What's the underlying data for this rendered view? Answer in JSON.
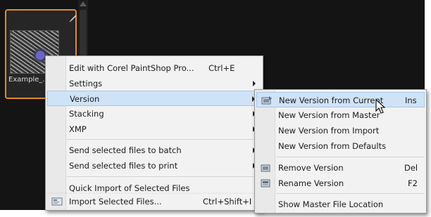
{
  "thumbnail": {
    "label": "Example_...S"
  },
  "main_menu": {
    "items": [
      {
        "label": "Edit with Corel PaintShop Pro...",
        "shortcut": "Ctrl+E"
      },
      {
        "label": "Settings"
      },
      {
        "label": "Version"
      },
      {
        "label": "Stacking"
      },
      {
        "label": "XMP"
      },
      {
        "label": "Send selected files to batch"
      },
      {
        "label": "Send selected files to print"
      },
      {
        "label": "Quick Import of Selected Files"
      },
      {
        "label": "Import Selected Files...",
        "shortcut": "Ctrl+Shift+I"
      }
    ]
  },
  "sub_menu": {
    "items": [
      {
        "label": "New Version from Current",
        "shortcut": "Ins"
      },
      {
        "label": "New Version from Master"
      },
      {
        "label": "New Version from Import"
      },
      {
        "label": "New Version from Defaults"
      },
      {
        "label": "Remove Version",
        "shortcut": "Del"
      },
      {
        "label": "Rename Version",
        "shortcut": "F2"
      },
      {
        "label": "Show Master File Location"
      }
    ]
  },
  "colors": {
    "highlight": "#cfe3f7",
    "selection_border": "#e48a2a"
  },
  "icons": [
    "pen-icon",
    "import-icon",
    "new-version-icon",
    "remove-version-icon",
    "rename-version-icon",
    "mouse-pointer-icon"
  ]
}
